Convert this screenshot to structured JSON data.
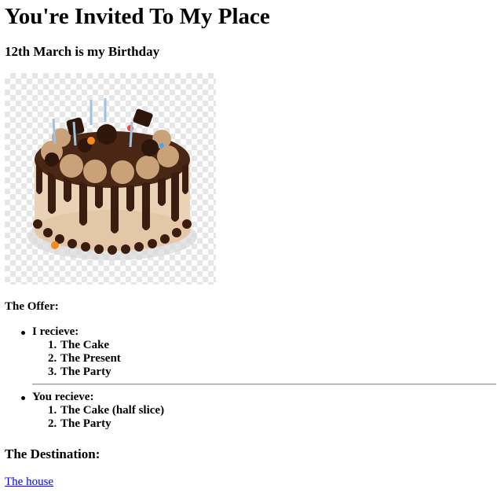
{
  "heading": "You're Invited To My Place",
  "subheading": "12th March is my Birthday",
  "image": {
    "icon": "birthday-cake-image"
  },
  "offer": {
    "title": "The Offer:",
    "groups": [
      {
        "label": "I recieve:",
        "items": [
          "The Cake",
          "The Present",
          "The Party"
        ]
      },
      {
        "label": "You recieve:",
        "items": [
          "The Cake (half slice)",
          "The Party"
        ]
      }
    ]
  },
  "destination": {
    "title": "The Destination:",
    "link_label": "The house"
  },
  "colors": {
    "link": "#0000ee",
    "text": "#000000"
  }
}
